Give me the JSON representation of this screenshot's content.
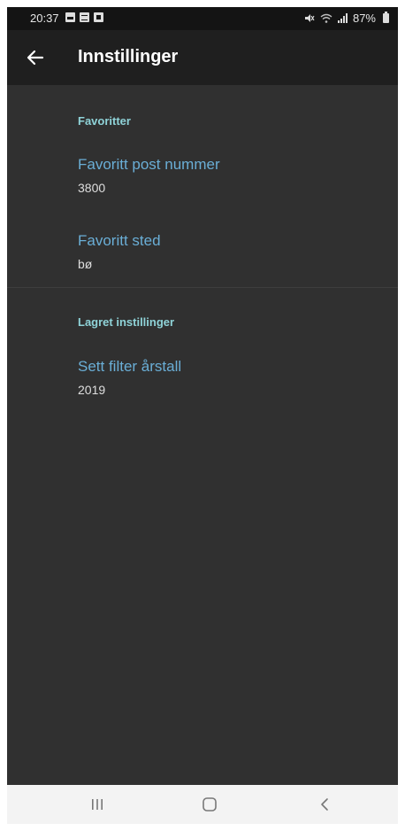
{
  "status_bar": {
    "time": "20:37",
    "battery": "87%"
  },
  "app_bar": {
    "title": "Innstillinger",
    "back_icon": "arrow-back-icon"
  },
  "sections": [
    {
      "header": "Favoritter",
      "items": [
        {
          "title": "Favoritt post nummer",
          "value": "3800"
        },
        {
          "title": "Favoritt sted",
          "value": "bø"
        }
      ]
    },
    {
      "header": "Lagret instillinger",
      "items": [
        {
          "title": "Sett filter årstall",
          "value": "2019"
        }
      ]
    }
  ],
  "nav_bar": {
    "recents_icon": "recents-icon",
    "home_icon": "home-icon",
    "back_icon": "nav-back-icon"
  },
  "colors": {
    "background": "#303030",
    "app_bar": "#1f1f1f",
    "section_header": "#8fd3d8",
    "pref_title": "#6aaed6",
    "pref_value": "#dedede"
  }
}
